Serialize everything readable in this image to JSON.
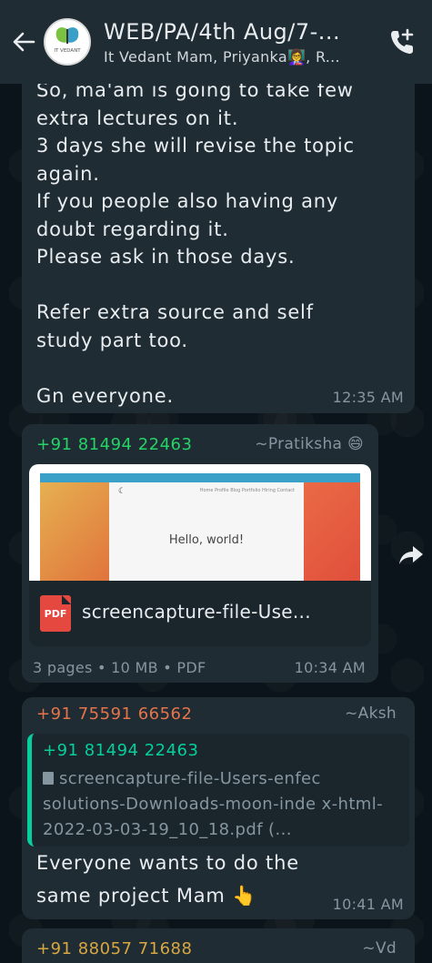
{
  "header": {
    "title": "WEB/PA/4th Aug/7-...",
    "subtitle": "It Vedant Mam, Priyanka👩‍🏫, R...",
    "avatar_text": "IT VEDANT"
  },
  "messages": [
    {
      "text": "So, ma'am is going to take few\nextra lectures on it.\n3 days she will revise the topic\nagain.\nIf you people also having any\ndoubt regarding it.\nPlease ask in those days.\n\nRefer extra source and self\nstudy part too.\n\nGn everyone.",
      "time": "12:35 AM"
    },
    {
      "sender": "+91 81494 22463",
      "push_name": "~Pratiksha 😄",
      "preview": {
        "hello": "Hello, world!",
        "nav": "Home  Profile  Blog  Portfolio  Hiring  Contact"
      },
      "file_name": "screencapture-file-Use...",
      "file_type": "PDF",
      "meta": "3 pages • 10 MB • PDF",
      "time": "10:34 AM"
    },
    {
      "sender": "+91 75591 66562",
      "push_name": "~Aksh",
      "quoted_sender": "+91 81494 22463",
      "quoted_text": "screencapture-file-Users-enfec solutions-Downloads-moon-inde x-html-2022-03-03-19_10_18.pdf (...",
      "text": "Everyone wants to do the same project Mam 👆",
      "time": "10:41 AM"
    },
    {
      "sender": "+91 88057 71688",
      "push_name": "~Vd"
    }
  ],
  "colors": {
    "background": "#0b141a",
    "bubble": "#1f2c34",
    "sender1": "#25d366",
    "sender2": "#e5744a",
    "sender3": "#d9a741",
    "quote_bar": "#06cf9c"
  }
}
